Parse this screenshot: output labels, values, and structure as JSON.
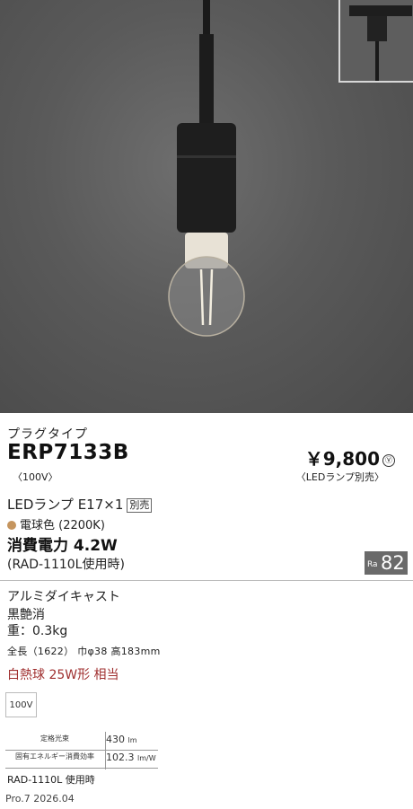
{
  "category": "プラグタイプ",
  "model": "ERP7133B",
  "voltage_note": "〈100V〉",
  "price": "￥9,800",
  "price_mark": "Ⓥ",
  "price_note": "〈LEDランプ別売〉",
  "lamp": "LEDランプ E17×1",
  "lamp_tag": "別売",
  "color": "電球色 (2200K)",
  "power": "消費電力 4.2W",
  "power_note": "(RAD-1110L使用時)",
  "ra_label": "Ra",
  "ra_value": "82",
  "finish": "アルミダイキャスト",
  "finish_color": "黒艶消",
  "weight": "重：0.3kg",
  "dimensions": "全長（1622） 巾φ38 高183mm",
  "equivalent": "白熱球 25W形 相当",
  "voltage_box": "100V",
  "spec_rows": [
    {
      "label": "定格光束",
      "value": "430",
      "unit": "lm"
    },
    {
      "label": "固有エネルギー消費効率",
      "value": "102.3",
      "unit": "lm/W"
    }
  ],
  "rad_use": "RAD-1110L 使用時",
  "pro_code": "Pro.7 2026.04",
  "colors": {
    "accent_red": "#a03030",
    "color_dot": "#c5955e",
    "ra_bg": "#6a6a6a"
  }
}
